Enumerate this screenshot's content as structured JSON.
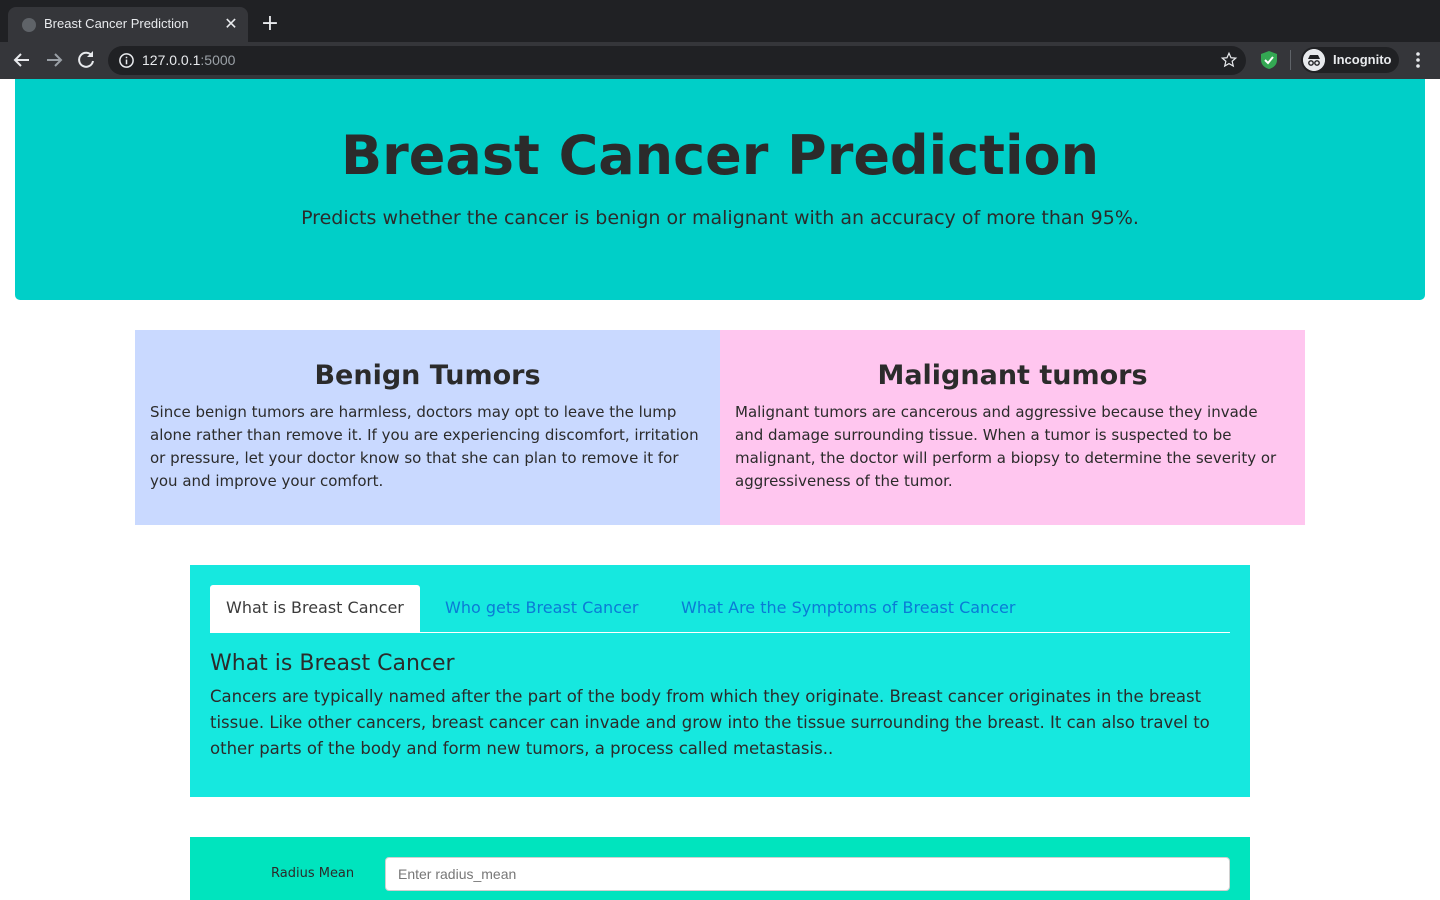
{
  "browser": {
    "tab_title": "Breast Cancer Prediction",
    "tab_close": "✕",
    "new_tab": "+",
    "url_host": "127.0.0.1",
    "url_port": ":5000",
    "profile_label": "Incognito"
  },
  "header": {
    "title": "Breast Cancer Prediction",
    "subtitle": "Predicts whether the cancer is benign or malignant with an accuracy of more than 95%."
  },
  "tumors": {
    "benign": {
      "title": "Benign Tumors",
      "text": "Since benign tumors are harmless, doctors may opt to leave the lump alone rather than remove it. If you are experiencing discomfort, irritation or pressure, let your doctor know so that she can plan to remove it for you and improve your comfort."
    },
    "malignant": {
      "title": "Malignant tumors",
      "text": "Malignant tumors are cancerous and aggressive because they invade and damage surrounding tissue. When a tumor is suspected to be malignant, the doctor will perform a biopsy to determine the severity or aggressiveness of the tumor."
    }
  },
  "info": {
    "tabs": [
      {
        "label": "What is Breast Cancer"
      },
      {
        "label": "Who gets Breast Cancer"
      },
      {
        "label": "What Are the Symptoms of Breast Cancer"
      }
    ],
    "heading": "What is Breast Cancer",
    "text": "Cancers are typically named after the part of the body from which they originate. Breast cancer originates in the breast tissue. Like other cancers, breast cancer can invade and grow into the tissue surrounding the breast. It can also travel to other parts of the body and form new tumors, a process called metastasis.."
  },
  "form": {
    "radius_mean_label": "Radius Mean",
    "radius_mean_placeholder": "Enter radius_mean",
    "radius_mean_value": ""
  },
  "colors": {
    "header_bg": "#00cfc8",
    "benign_bg": "#c9d9ff",
    "malignant_bg": "#ffc6ef",
    "info_bg": "#16e8df",
    "form_bg": "#00e4be",
    "tab_link": "#0a7bd6"
  }
}
